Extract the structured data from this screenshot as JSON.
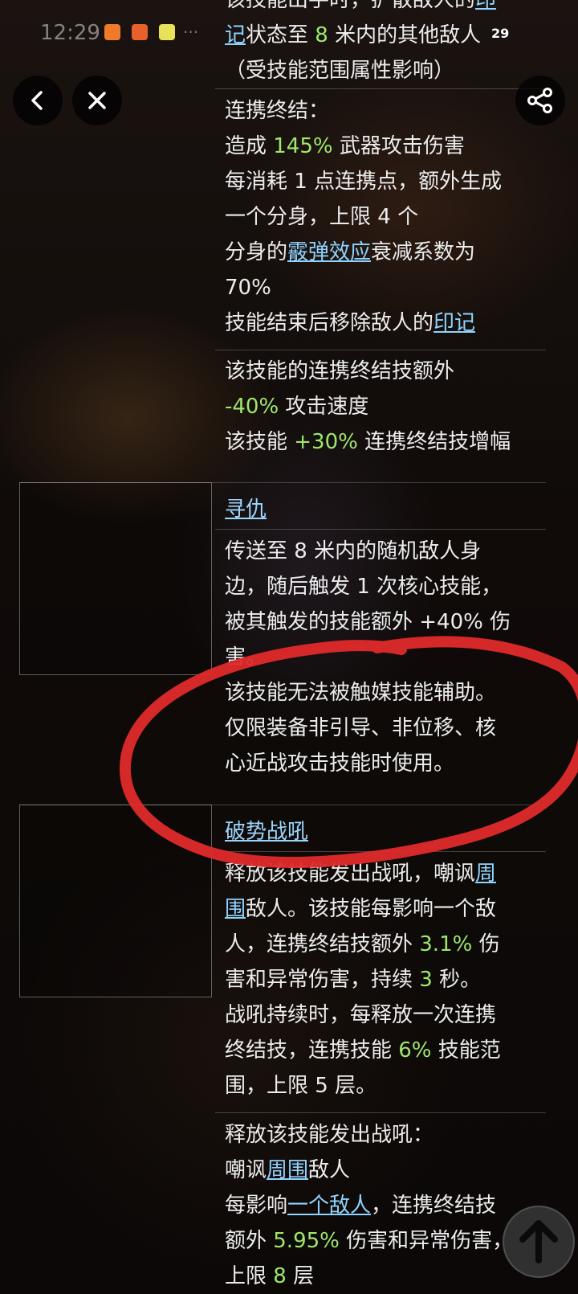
{
  "status_bar": {
    "time": "12:29",
    "battery": "29"
  },
  "nav": {
    "back_icon": "chevron-left-icon",
    "close_icon": "close-icon",
    "share_icon": "share-icon"
  },
  "colors": {
    "highlight": "#9ee86b",
    "link": "#8fd3ff",
    "annotation": "#e02a2a"
  },
  "section1": {
    "top_a": "该技能出手时，扩散敌人的",
    "top_link": "印",
    "top_b_link": "记",
    "top_b": "状态至 ",
    "top_num": "8",
    "top_c": " 米内的其他敌人",
    "top_line3": "（受技能范围属性影响）",
    "combo_title": "连携终结：",
    "dmg_a": "造成 ",
    "dmg_val": "145%",
    "dmg_b": " 武器攻击伤害",
    "line_clone1": "每消耗 1 点连携点，额外生成",
    "line_clone2": "一个分身，上限 4 个",
    "clone_a": "分身的",
    "clone_link": "霰弹效应",
    "clone_b": "衰减系数为",
    "clone_val": "70%",
    "remove_a": "技能结束后移除敌人的",
    "remove_link": "印记",
    "extra1": "该技能的连携终结技额外",
    "speed_val": "-40%",
    "speed_b": " 攻击速度",
    "boost_a": "该技能 ",
    "boost_val": "+30%",
    "boost_b": " 连携终结技增幅"
  },
  "section2": {
    "title": "寻仇",
    "line1": "传送至 8 米内的随机敌人身",
    "line2": "边，随后触发 1 次核心技能，",
    "line3": "被其触发的技能额外 +40% 伤",
    "line4": "害。",
    "line5": "该技能无法被触媒技能辅助。",
    "line6": "仅限装备非引导、非位移、核",
    "line7": "心近战攻击技能时使用。"
  },
  "section3": {
    "title": "破势战吼",
    "l1_a": "释放该技能发出战吼，嘲讽",
    "l1_link": "周",
    "l2_link": "围",
    "l2_b": "敌人。该技能每影响一个敌",
    "l3_a": "人，连携终结技额外 ",
    "l3_val": "3.1%",
    "l3_b": " 伤",
    "l4_a": "害和异常伤害，持续 ",
    "l4_val": "3",
    "l4_b": " 秒。",
    "l5": "战吼持续时，每释放一次连携",
    "l6_a": "终结技，连携技能 ",
    "l6_val": "6%",
    "l6_b": " 技能范",
    "l7": "围，上限 5 层。",
    "l8": "释放该技能发出战吼：",
    "l9_a": "嘲讽",
    "l9_link": "周围",
    "l9_b": "敌人",
    "l10_a": "每影响",
    "l10_link": "一个敌人",
    "l10_b": "，连携终结技",
    "l11_a": "额外 ",
    "l11_val": "5.95%",
    "l11_b": " 伤害和异常伤害，",
    "l12_a": "上限 ",
    "l12_val": "8",
    "l12_b": " 层"
  },
  "scroll_top_icon": "arrow-up-icon"
}
